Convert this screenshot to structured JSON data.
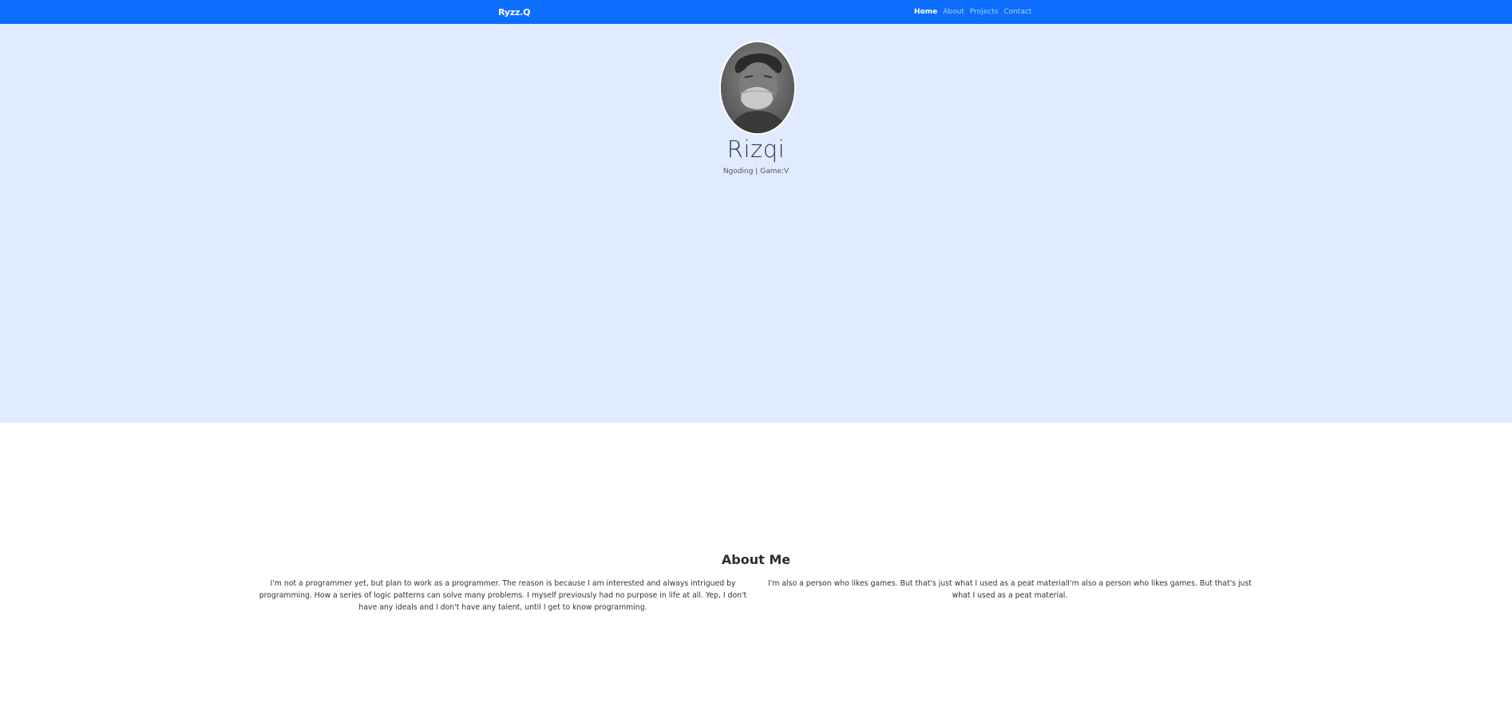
{
  "navbar": {
    "brand": "Ryzz.Q",
    "links": [
      {
        "label": "Home",
        "active": true
      },
      {
        "label": "About",
        "active": false
      },
      {
        "label": "Projects",
        "active": false
      },
      {
        "label": "Contact",
        "active": false
      }
    ]
  },
  "hero": {
    "name": "Rizqi",
    "subtitle": "Ngoding | Game:V"
  },
  "about": {
    "title": "About Me",
    "paragraph_left": "I'm not a programmer yet, but plan to work as a programmer. The reason is because I am interested and always intrigued by programming. How a series of logic patterns can solve many problems. I myself previously had no purpose in life at all. Yep, I don't have any ideals and I don't have any talent, until I get to know programming.",
    "paragraph_right": "I'm also a person who likes games. But that's just what I used as a peat materialI'm also a person who likes games. But that's just what I used as a peat material."
  },
  "colors": {
    "navbar": "#0d6efd",
    "hero_background": "#e0ebff",
    "page_background": "#ffffff"
  }
}
